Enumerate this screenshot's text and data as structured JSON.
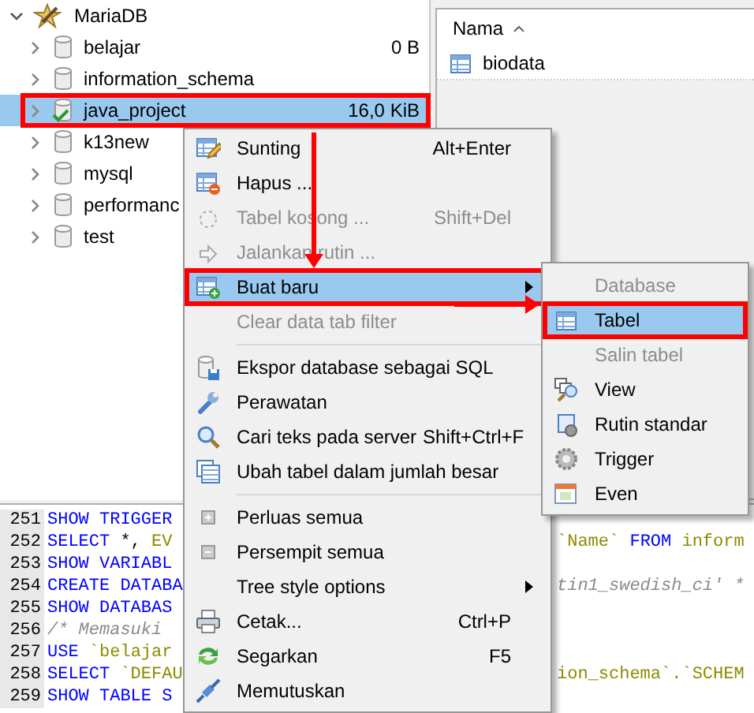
{
  "tree": {
    "root": {
      "label": "MariaDB",
      "expanded": true,
      "children": [
        {
          "label": "belajar",
          "size": "0 B",
          "expanded": false,
          "selected": false,
          "callout": false
        },
        {
          "label": "information_schema",
          "expanded": false,
          "selected": false,
          "callout": false
        },
        {
          "label": "java_project",
          "size": "16,0 KiB",
          "expanded": false,
          "selected": true,
          "callout": true
        },
        {
          "label": "k13new",
          "expanded": false,
          "selected": false,
          "callout": false
        },
        {
          "label": "mysql",
          "expanded": false,
          "selected": false,
          "callout": false
        },
        {
          "label": "performanc",
          "expanded": false,
          "selected": false,
          "callout": false
        },
        {
          "label": "test",
          "expanded": false,
          "selected": false,
          "callout": false
        }
      ]
    }
  },
  "table_list": {
    "column": "Nama",
    "rows": [
      "biodata"
    ]
  },
  "editor": {
    "lines": [
      {
        "number": "251",
        "left": [
          {
            "text": "SHOW TRIGGER",
            "kind": "keyword"
          }
        ]
      },
      {
        "number": "252",
        "left": [
          {
            "text": "SELECT",
            "kind": "keyword"
          },
          {
            "text": " *, ",
            "kind": "plain"
          },
          {
            "text": "EV",
            "kind": "string"
          }
        ],
        "right": [
          {
            "text": "`Name` ",
            "kind": "string"
          },
          {
            "text": "FROM",
            "kind": "keyword"
          },
          {
            "text": " inform",
            "kind": "string"
          }
        ]
      },
      {
        "number": "253",
        "left": [
          {
            "text": "SHOW VARIABL",
            "kind": "keyword"
          }
        ]
      },
      {
        "number": "254",
        "left": [
          {
            "text": "CREATE DATABA",
            "kind": "keyword"
          }
        ],
        "right": [
          {
            "text": "tin1_swedish_ci' *",
            "kind": "comment"
          }
        ]
      },
      {
        "number": "255",
        "left": [
          {
            "text": "SHOW DATABAS",
            "kind": "keyword"
          }
        ]
      },
      {
        "number": "256",
        "left": [
          {
            "text": "/* Memasuki",
            "kind": "comment"
          }
        ]
      },
      {
        "number": "257",
        "left": [
          {
            "text": "USE",
            "kind": "keyword"
          },
          {
            "text": " `belajar",
            "kind": "string"
          }
        ]
      },
      {
        "number": "258",
        "left": [
          {
            "text": "SELECT",
            "kind": "keyword"
          },
          {
            "text": " `DEFAU",
            "kind": "string"
          }
        ],
        "right": [
          {
            "text": "ion_schema`.`SCHEM",
            "kind": "string"
          }
        ]
      },
      {
        "number": "259",
        "left": [
          {
            "text": "SHOW TABLE S",
            "kind": "keyword"
          }
        ]
      }
    ]
  },
  "context_menu": {
    "items": [
      {
        "kind": "item",
        "label": "Sunting",
        "shortcut": "Alt+Enter",
        "disabled": false,
        "selected": false,
        "callout": false,
        "has_submenu": false
      },
      {
        "kind": "item",
        "label": "Hapus ...",
        "disabled": false,
        "selected": false,
        "callout": false,
        "has_submenu": false
      },
      {
        "kind": "item",
        "label": "Tabel kosong ...",
        "shortcut": "Shift+Del",
        "disabled": true,
        "selected": false,
        "callout": false,
        "has_submenu": false
      },
      {
        "kind": "item",
        "label": "Jalankan rutin ...",
        "disabled": true,
        "selected": false,
        "callout": false,
        "has_submenu": false
      },
      {
        "kind": "item",
        "label": "Buat baru",
        "disabled": false,
        "selected": true,
        "callout": true,
        "has_submenu": true
      },
      {
        "kind": "item",
        "label": "Clear data tab filter",
        "disabled": true,
        "selected": false,
        "callout": false,
        "has_submenu": false
      },
      {
        "kind": "separator"
      },
      {
        "kind": "item",
        "label": "Ekspor database sebagai SQL",
        "disabled": false,
        "selected": false,
        "callout": false,
        "has_submenu": false
      },
      {
        "kind": "item",
        "label": "Perawatan",
        "disabled": false,
        "selected": false,
        "callout": false,
        "has_submenu": false
      },
      {
        "kind": "item",
        "label": "Cari teks pada server",
        "shortcut": "Shift+Ctrl+F",
        "disabled": false,
        "selected": false,
        "callout": false,
        "has_submenu": false
      },
      {
        "kind": "item",
        "label": "Ubah tabel dalam jumlah besar",
        "disabled": false,
        "selected": false,
        "callout": false,
        "has_submenu": false
      },
      {
        "kind": "separator"
      },
      {
        "kind": "item",
        "label": "Perluas semua",
        "disabled": false,
        "selected": false,
        "callout": false,
        "has_submenu": false
      },
      {
        "kind": "item",
        "label": "Persempit semua",
        "disabled": false,
        "selected": false,
        "callout": false,
        "has_submenu": false
      },
      {
        "kind": "item",
        "label": "Tree style options",
        "disabled": false,
        "selected": false,
        "callout": false,
        "has_submenu": true
      },
      {
        "kind": "item",
        "label": "Cetak...",
        "shortcut": "Ctrl+P",
        "disabled": false,
        "selected": false,
        "callout": false,
        "has_submenu": false
      },
      {
        "kind": "item",
        "label": "Segarkan",
        "shortcut": "F5",
        "disabled": false,
        "selected": false,
        "callout": false,
        "has_submenu": false
      },
      {
        "kind": "item",
        "label": "Memutuskan",
        "disabled": false,
        "selected": false,
        "callout": false,
        "has_submenu": false
      }
    ]
  },
  "submenu": {
    "items": [
      {
        "kind": "item",
        "label": "Database",
        "disabled": true,
        "selected": false,
        "callout": false,
        "has_submenu": false
      },
      {
        "kind": "item",
        "label": "Tabel",
        "disabled": false,
        "selected": true,
        "callout": true,
        "has_submenu": false
      },
      {
        "kind": "item",
        "label": "Salin tabel",
        "disabled": true,
        "selected": false,
        "callout": false,
        "has_submenu": false
      },
      {
        "kind": "item",
        "label": "View",
        "disabled": false,
        "selected": false,
        "callout": false,
        "has_submenu": false
      },
      {
        "kind": "item",
        "label": "Rutin standar",
        "disabled": false,
        "selected": false,
        "callout": false,
        "has_submenu": false
      },
      {
        "kind": "item",
        "label": "Trigger",
        "disabled": false,
        "selected": false,
        "callout": false,
        "has_submenu": false
      },
      {
        "kind": "item",
        "label": "Even",
        "disabled": false,
        "selected": false,
        "callout": false,
        "has_submenu": false
      }
    ]
  }
}
